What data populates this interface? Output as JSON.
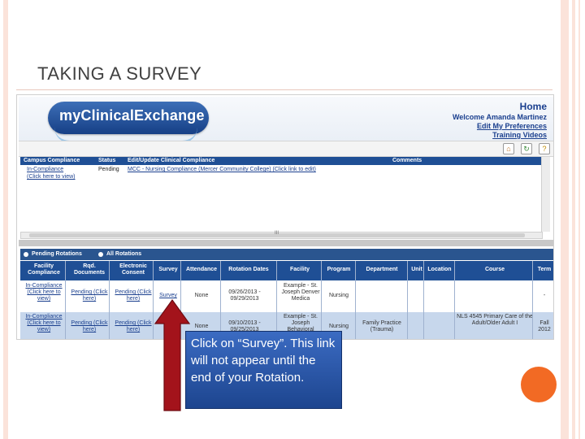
{
  "slide": {
    "title": "TAKING A SURVEY"
  },
  "app": {
    "logo": "myClinicalExchange",
    "header": {
      "home": "Home",
      "welcome": "Welcome Amanda Martinez",
      "prefs": "Edit My Preferences",
      "training": "Training Videos"
    },
    "compliance": {
      "columns": [
        "Campus Compliance",
        "Status",
        "Edit/Update Clinical Compliance",
        "Comments"
      ],
      "row": {
        "campus_1": "In-Compliance",
        "campus_2": "(Click here to view)",
        "status": "Pending",
        "edit": "MCC - Nursing Compliance (Mercer Community College) (Click link to edit)",
        "comments": ""
      },
      "scroll_marker": "III"
    },
    "tabs": {
      "pending": "Pending Rotations",
      "all": "All Rotations"
    },
    "rotations": {
      "columns": [
        "Facility Compliance",
        "Rqd. Documents",
        "Electronic Consent",
        "Survey",
        "Attendance",
        "Rotation Dates",
        "Facility",
        "Program",
        "Department",
        "Unit",
        "Location",
        "Course",
        "Term"
      ],
      "rows": [
        {
          "facility_compliance": "In-Compliance (Click here to view)",
          "rqd_documents": "Pending (Click here)",
          "electronic_consent": "Pending (Click here)",
          "survey": "Survey",
          "attendance": "None",
          "rotation_dates": "09/26/2013 - 09/29/2013",
          "facility": "Example - St. Joseph Denver Medica",
          "program": "Nursing",
          "department": "",
          "unit": "",
          "location": "",
          "course": "",
          "term": "-"
        },
        {
          "facility_compliance": "In-Compliance (Click here to view)",
          "rqd_documents": "Pending (Click here)",
          "electronic_consent": "Pending (Click here)",
          "survey": "",
          "attendance": "None",
          "rotation_dates": "09/10/2013 - 09/25/2013",
          "facility": "Example - St. Joseph Behavioral",
          "program": "Nursing",
          "department": "Family Practice (Trauma)",
          "unit": "",
          "location": "",
          "course": "NLS 4545 Primary Care of the Adult/Older Adult I",
          "term": "Fall 2012"
        }
      ]
    }
  },
  "callout": {
    "text": "Click on “Survey”. This link will not appear until the end of your Rotation."
  },
  "colors": {
    "accent": "#1f4f95",
    "arrow": "#a3131b",
    "dot": "#f26a24"
  }
}
